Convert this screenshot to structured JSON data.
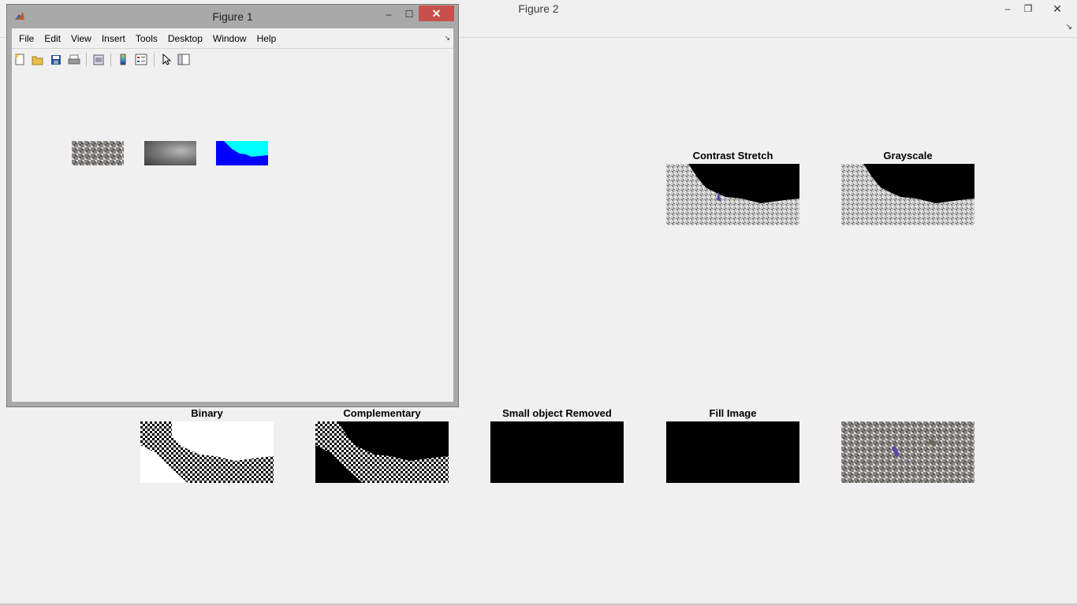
{
  "figure2": {
    "title": "Figure 2",
    "controls": {
      "minimize": "–",
      "maximize": "❐",
      "close": "✕"
    },
    "dock_glyph": "↘",
    "subplots": [
      {
        "title": "Contrast Stretch",
        "image": "texture-top-black"
      },
      {
        "title": "Grayscale",
        "image": "texture-top-black"
      },
      {
        "title": "Binary",
        "image": "binary"
      },
      {
        "title": "Complementary",
        "image": "complementary"
      },
      {
        "title": "Small object Removed",
        "image": "black"
      },
      {
        "title": "Fill Image",
        "image": "black"
      },
      {
        "title": "",
        "image": "original-color"
      }
    ]
  },
  "figure1": {
    "title": "Figure 1",
    "controls": {
      "minimize": "–",
      "maximize": "☐",
      "close": "✕"
    },
    "menu": [
      "File",
      "Edit",
      "View",
      "Insert",
      "Tools",
      "Desktop",
      "Window",
      "Help"
    ],
    "dock_glyph": "↘",
    "toolbar": [
      {
        "icon": "new-figure-icon",
        "glyph": "▫"
      },
      {
        "icon": "open-file-icon",
        "glyph": "📂"
      },
      {
        "icon": "save-icon",
        "glyph": "💾"
      },
      {
        "icon": "print-icon",
        "glyph": "🖶"
      },
      {
        "icon": "print-preview-icon",
        "glyph": "▤"
      },
      {
        "icon": "insert-colorbar-icon",
        "glyph": "▮"
      },
      {
        "icon": "insert-legend-icon",
        "glyph": "☷"
      },
      {
        "icon": "edit-plot-icon",
        "glyph": "➚"
      },
      {
        "icon": "show-plot-tools-icon",
        "glyph": "◫"
      }
    ],
    "thumbnails": [
      "original-image",
      "grayscale-image",
      "segmented-color-image"
    ],
    "colors": {
      "close_button": "#c7504a",
      "blue": "#0000ff",
      "cyan": "#00ffff"
    }
  }
}
